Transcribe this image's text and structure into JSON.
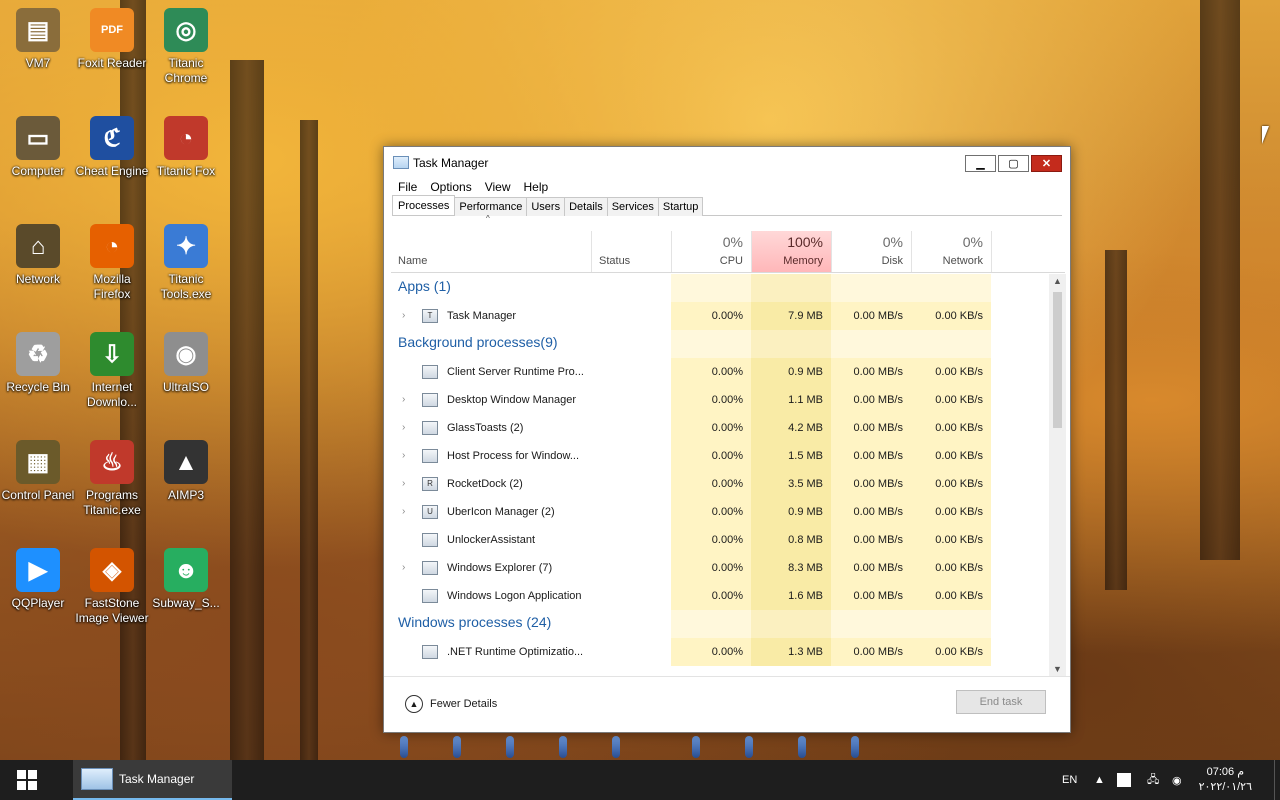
{
  "desktop_icons": [
    {
      "label": "VM7",
      "icon": "vm-icon",
      "color": "#8a6d3b"
    },
    {
      "label": "Foxit Reader",
      "icon": "pdf-icon",
      "color": "#f08a24"
    },
    {
      "label": "Titanic Chrome",
      "icon": "chrome-icon",
      "color": "#2e8b57"
    },
    {
      "label": "Computer",
      "icon": "computer-icon",
      "color": "#6b5a3a"
    },
    {
      "label": "Cheat Engine",
      "icon": "cheat-engine-icon",
      "color": "#1f4fa0"
    },
    {
      "label": "Titanic Fox",
      "icon": "firefox-icon",
      "color": "#c0392b"
    },
    {
      "label": "Network",
      "icon": "network-icon",
      "color": "#5a4a2a"
    },
    {
      "label": "Mozilla Firefox",
      "icon": "firefox-icon",
      "color": "#e66000"
    },
    {
      "label": "Titanic Tools.exe",
      "icon": "tools-icon",
      "color": "#3a7bd5"
    },
    {
      "label": "Recycle Bin",
      "icon": "recycle-bin-icon",
      "color": "#9e9e9e"
    },
    {
      "label": "Internet Downlo...",
      "icon": "download-icon",
      "color": "#2e8b2e"
    },
    {
      "label": "UltraISO",
      "icon": "disc-icon",
      "color": "#8e8e8e"
    },
    {
      "label": "Control Panel",
      "icon": "control-panel-icon",
      "color": "#6b5a2a"
    },
    {
      "label": "Programs Titanic.exe",
      "icon": "programs-icon",
      "color": "#c0392b"
    },
    {
      "label": "AIMP3",
      "icon": "aimp-icon",
      "color": "#333333"
    },
    {
      "label": "QQPlayer",
      "icon": "qqplayer-icon",
      "color": "#1e90ff"
    },
    {
      "label": "FastStone Image Viewer",
      "icon": "faststone-icon",
      "color": "#d35400"
    },
    {
      "label": "Subway_S...",
      "icon": "subway-icon",
      "color": "#27ae60"
    }
  ],
  "window": {
    "title": "Task Manager",
    "menu": [
      "File",
      "Options",
      "View",
      "Help"
    ],
    "tabs": [
      "Processes",
      "Performance",
      "Users",
      "Details",
      "Services",
      "Startup"
    ],
    "columns": {
      "name": "Name",
      "status": "Status",
      "cpu": {
        "pct": "0%",
        "label": "CPU"
      },
      "memory": {
        "pct": "100%",
        "label": "Memory"
      },
      "disk": {
        "pct": "0%",
        "label": "Disk"
      },
      "network": {
        "pct": "0%",
        "label": "Network"
      }
    },
    "rows": [
      {
        "type": "group",
        "label": "Apps (1)"
      },
      {
        "type": "proc",
        "name": "Task Manager",
        "expand": true,
        "icon": "T",
        "cpu": "0.00%",
        "mem": "7.9 MB",
        "disk": "0.00 MB/s",
        "net": "0.00 KB/s"
      },
      {
        "type": "group",
        "label": "Background processes(9)"
      },
      {
        "type": "proc",
        "name": "Client Server Runtime Pro...",
        "expand": false,
        "icon": "",
        "cpu": "0.00%",
        "mem": "0.9 MB",
        "disk": "0.00 MB/s",
        "net": "0.00 KB/s"
      },
      {
        "type": "proc",
        "name": "Desktop Window Manager",
        "expand": true,
        "icon": "",
        "cpu": "0.00%",
        "mem": "1.1 MB",
        "disk": "0.00 MB/s",
        "net": "0.00 KB/s"
      },
      {
        "type": "proc",
        "name": "GlassToasts (2)",
        "expand": true,
        "icon": "",
        "cpu": "0.00%",
        "mem": "4.2 MB",
        "disk": "0.00 MB/s",
        "net": "0.00 KB/s"
      },
      {
        "type": "proc",
        "name": "Host Process for Window...",
        "expand": true,
        "icon": "",
        "cpu": "0.00%",
        "mem": "1.5 MB",
        "disk": "0.00 MB/s",
        "net": "0.00 KB/s"
      },
      {
        "type": "proc",
        "name": "RocketDock (2)",
        "expand": true,
        "icon": "R",
        "cpu": "0.00%",
        "mem": "3.5 MB",
        "disk": "0.00 MB/s",
        "net": "0.00 KB/s"
      },
      {
        "type": "proc",
        "name": "UberIcon Manager (2)",
        "expand": true,
        "icon": "U",
        "cpu": "0.00%",
        "mem": "0.9 MB",
        "disk": "0.00 MB/s",
        "net": "0.00 KB/s"
      },
      {
        "type": "proc",
        "name": "UnlockerAssistant",
        "expand": false,
        "icon": "",
        "cpu": "0.00%",
        "mem": "0.8 MB",
        "disk": "0.00 MB/s",
        "net": "0.00 KB/s"
      },
      {
        "type": "proc",
        "name": "Windows Explorer (7)",
        "expand": true,
        "icon": "",
        "cpu": "0.00%",
        "mem": "8.3 MB",
        "disk": "0.00 MB/s",
        "net": "0.00 KB/s"
      },
      {
        "type": "proc",
        "name": "Windows Logon Application",
        "expand": false,
        "icon": "",
        "cpu": "0.00%",
        "mem": "1.6 MB",
        "disk": "0.00 MB/s",
        "net": "0.00 KB/s"
      },
      {
        "type": "group",
        "label": "Windows processes (24)"
      },
      {
        "type": "proc",
        "name": ".NET Runtime Optimizatio...",
        "expand": false,
        "icon": "",
        "cpu": "0.00%",
        "mem": "1.3 MB",
        "disk": "0.00 MB/s",
        "net": "0.00 KB/s"
      }
    ],
    "footer": {
      "fewer_details": "Fewer Details",
      "end_task": "End task"
    }
  },
  "taskbar": {
    "app_label": "Task Manager",
    "language": "EN",
    "time": "07:06 م",
    "date": "٢٠٢٢/٠١/٢٦"
  },
  "colors": {
    "accent": "#76b9ed",
    "memory_hot": "#ffb7b9",
    "group_text": "#1f5fa6"
  }
}
